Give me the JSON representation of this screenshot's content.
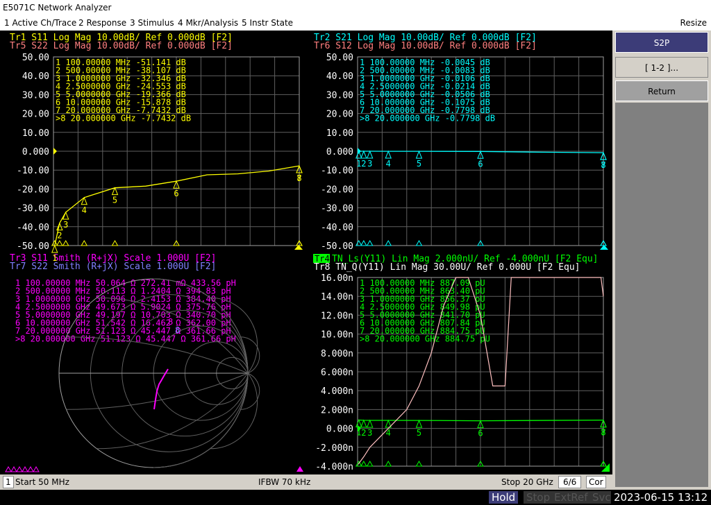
{
  "app": {
    "title": "E5071C Network Analyzer"
  },
  "menu": [
    {
      "label": "1 Active Ch/Trace"
    },
    {
      "label": "2 Response"
    },
    {
      "label": "3 Stimulus"
    },
    {
      "label": "4 Mkr/Analysis"
    },
    {
      "label": "5 Instr State"
    }
  ],
  "menu_resize": "Resize",
  "softkeys": {
    "s2p": "S2P",
    "range": "[ 1-2 ]...",
    "return": "Return"
  },
  "status": {
    "channel": "1",
    "start": "Start 50 MHz",
    "ifbw": "IFBW 70 kHz",
    "stop": "Stop 20 GHz",
    "count": "6/6",
    "cor": "Cor"
  },
  "bottom": {
    "hold": "Hold",
    "stop": "Stop",
    "extref": "ExtRef",
    "svc": "Svc",
    "datetime": "2023-06-15 13:12"
  },
  "colors": {
    "yellow": "#ffff00",
    "salmon": "#ff8080",
    "cyan": "#00ffff",
    "magenta": "#ff00ff",
    "violet": "#8080ff",
    "green": "#00ff00",
    "pink": "#ffc0c0",
    "grid": "#606060"
  },
  "panels": {
    "tl": {
      "headers": [
        {
          "text": "Tr1 S11 Log Mag 10.00dB/ Ref 0.000dB [F2]",
          "color": "#ffff00"
        },
        {
          "text": "Tr5 S22 Log Mag 10.00dB/ Ref 0.000dB [F2]",
          "color": "#ff8080"
        }
      ],
      "yticks": [
        "50.00",
        "40.00",
        "30.00",
        "20.00",
        "10.00",
        "0.000",
        "-10.00",
        "-20.00",
        "-30.00",
        "-40.00",
        "-50.00"
      ],
      "marker_color": "#ffff00",
      "markers": [
        "1   100.00000 MHz -51.141 dB",
        "2   500.00000 MHz -38.107 dB",
        "3   1.0000000 GHz -32.346 dB",
        "4   2.5000000 GHz -24.553 dB",
        "5   5.0000000 GHz -19.366 dB",
        "6   10.000000 GHz -15.878 dB",
        "7   20.000000 GHz -7.7432 dB",
        ">8  20.000000 GHz -7.7432 dB"
      ]
    },
    "tr": {
      "headers": [
        {
          "text": "Tr2 S21 Log Mag 10.00dB/ Ref 0.000dB [F2]",
          "color": "#00ffff"
        },
        {
          "text": "Tr6 S12 Log Mag 10.00dB/ Ref 0.000dB [F2]",
          "color": "#ff8080"
        }
      ],
      "yticks": [
        "50.00",
        "40.00",
        "30.00",
        "20.00",
        "10.00",
        "0.000",
        "-10.00",
        "-20.00",
        "-30.00",
        "-40.00",
        "-50.00"
      ],
      "marker_color": "#00ffff",
      "markers": [
        "1   100.00000 MHz -0.0045 dB",
        "2   500.00000 MHz -0.0083 dB",
        "3   1.0000000 GHz -0.0106 dB",
        "4   2.5000000 GHz -0.0214 dB",
        "5   5.0000000 GHz -0.0506 dB",
        "6   10.000000 GHz -0.1075 dB",
        "7   20.000000 GHz -0.7798 dB",
        ">8  20.000000 GHz -0.7798 dB"
      ]
    },
    "bl": {
      "headers": [
        {
          "text": "Tr3 S11 Smith (R+jX) Scale 1.000U [F2]",
          "color": "#ff00ff"
        },
        {
          "text": "Tr7 S22 Smith (R+jX) Scale 1.000U [F2]",
          "color": "#8080ff"
        }
      ],
      "marker_color": "#ff00ff",
      "markers": [
        "1   100.00000 MHz  50.064 Ω  272.41 mΩ  433.56 pH",
        "2   500.00000 MHz  50.113 Ω  1.2404 Ω   394.83 pH",
        "3   1.0000000 GHz  50.096 Ω  2.4153 Ω   384.40 pH",
        "4   2.5000000 GHz  49.673 Ω  5.9024 Ω   375.76 pH",
        "5   5.0000000 GHz  49.197 Ω  10.703 Ω   340.70 pH",
        "6   10.000000 GHz  51.542 Ω  16.462 Ω   362.00 pH",
        "7   20.000000 GHz  51.123 Ω  45.447 Ω   361.66 pH",
        ">8  20.000000 GHz  51.123 Ω  45.447 Ω   361.66 pH"
      ]
    },
    "br": {
      "headers": [
        {
          "text": "Tr4",
          "color": "#00ff00"
        },
        {
          "text": "TN_Ls(Y11) Lin Mag 2.000nU/ Ref -4.000nU [F2 Equ]",
          "color": "#00ff00"
        },
        {
          "text": "Tr8 TN_Q(Y11) Lin Mag 30.00U/ Ref 0.000U [F2 Equ]",
          "color": "#ffffff"
        }
      ],
      "yticks": [
        "16.00n",
        "14.00n",
        "12.00n",
        "10.00n",
        "8.000n",
        "6.000n",
        "4.000n",
        "2.000n",
        "0.000",
        "-2.000n",
        "-4.000n"
      ],
      "marker_color": "#00ff00",
      "markers": [
        "1   100.00000 MHz  887.09 pU",
        "2   500.00000 MHz  863.40 pU",
        "3   1.0000000 GHz  856.37 pU",
        "4   2.5000000 GHz  849.98 pU",
        "5   5.0000000 GHz  841.70 pU",
        "6   10.000000 GHz  807.84 pU",
        "7   20.000000 GHz  884.75 pU",
        ">8  20.000000 GHz  884.75 pU"
      ]
    }
  },
  "chart_data": [
    {
      "type": "line",
      "title": "Tr1 S11 Log Mag",
      "x": [
        0.05,
        0.1,
        0.5,
        1,
        2.5,
        5,
        7.5,
        10,
        12.5,
        15,
        17.5,
        20
      ],
      "series": [
        {
          "name": "Tr1 S11",
          "values": [
            -52,
            -51.141,
            -38.107,
            -32.346,
            -24.553,
            -19.366,
            -18.5,
            -15.878,
            -12.5,
            -12.0,
            -10.5,
            -7.7432
          ]
        }
      ],
      "ylim": [
        -50,
        50
      ],
      "markers_ghz": [
        0.1,
        0.5,
        1,
        2.5,
        5,
        10,
        20,
        20
      ]
    },
    {
      "type": "line",
      "title": "Tr2 S21 Log Mag",
      "x": [
        0.05,
        0.1,
        0.5,
        1,
        2.5,
        5,
        10,
        15,
        20
      ],
      "series": [
        {
          "name": "Tr2 S21",
          "values": [
            -0.004,
            -0.0045,
            -0.0083,
            -0.0106,
            -0.0214,
            -0.0506,
            -0.1075,
            -0.5,
            -0.7798
          ]
        }
      ],
      "ylim": [
        -50,
        50
      ],
      "markers_ghz": [
        0.1,
        0.5,
        1,
        2.5,
        5,
        10,
        20,
        20
      ]
    },
    {
      "type": "line",
      "title": "Tr4 TN_Ls(Y11) Lin Mag",
      "x": [
        0.05,
        0.1,
        0.5,
        1,
        2.5,
        5,
        10,
        20
      ],
      "series": [
        {
          "name": "Tr4 TN_Ls",
          "values": [
            0.887,
            0.887,
            0.863,
            0.856,
            0.85,
            0.842,
            0.808,
            0.885
          ]
        }
      ],
      "ylim": [
        -4,
        16
      ],
      "markers_ghz": [
        0.1,
        0.5,
        1,
        2.5,
        5,
        10,
        20,
        20
      ]
    },
    {
      "type": "line",
      "title": "Tr8 TN_Q(Y11) Lin Mag",
      "x": [
        0.05,
        0.5,
        1,
        2.5,
        4,
        5,
        6,
        7,
        8,
        9,
        10,
        11,
        12,
        12.5,
        19.8,
        20
      ],
      "series": [
        {
          "name": "Tr8 TN_Q",
          "values": [
            -3.8,
            -3.0,
            -2.0,
            0.0,
            2.0,
            4.5,
            8.0,
            13.0,
            16,
            16,
            12,
            4.5,
            4.5,
            16,
            16,
            14
          ]
        }
      ],
      "ylim": [
        -4,
        16
      ]
    }
  ]
}
